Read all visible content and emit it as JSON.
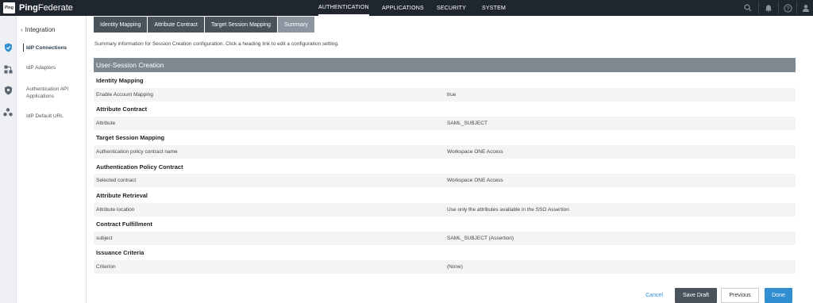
{
  "app": {
    "logo_text": "Ping",
    "brand_bold": "Ping",
    "brand_rest": "Federate"
  },
  "topnav": {
    "items": [
      {
        "label": "AUTHENTICATION",
        "active": true
      },
      {
        "label": "APPLICATIONS",
        "active": false
      },
      {
        "label": "SECURITY",
        "active": false
      },
      {
        "label": "SYSTEM",
        "active": false
      }
    ],
    "icons": [
      "search-icon",
      "bell-icon",
      "help-icon",
      "user-icon"
    ]
  },
  "rail": {
    "icons": [
      "shield-check-icon",
      "connections-icon",
      "shield-icon",
      "cluster-icon"
    ],
    "accent": "#2f8fd0"
  },
  "sidebar": {
    "back_label": "Integration",
    "items": [
      {
        "label": "IdP Connections",
        "active": true
      },
      {
        "label": "IdP Adapters",
        "active": false
      },
      {
        "label": "Authentication API Applications",
        "active": false
      },
      {
        "label": "IdP Default URL",
        "active": false
      }
    ]
  },
  "tabs": [
    {
      "label": "Identity Mapping",
      "active": false
    },
    {
      "label": "Attribute Contract",
      "active": false
    },
    {
      "label": "Target Session Mapping",
      "active": false
    },
    {
      "label": "Summary",
      "active": true
    }
  ],
  "summary_text": "Summary information for Session Creation configuration. Click a heading link to edit a configuration setting.",
  "section_header": "User-Session Creation",
  "groups": [
    {
      "heading": "Identity Mapping",
      "label": "Enable Account Mapping",
      "value": "true"
    },
    {
      "heading": "Attribute Contract",
      "label": "Attribute",
      "value": "SAML_SUBJECT"
    },
    {
      "heading": "Target Session Mapping",
      "label": "Authentication policy contract name",
      "value": "Workspace ONE Access"
    },
    {
      "heading": "Authentication Policy Contract",
      "label": "Selected contract",
      "value": "Workspace ONE Access"
    },
    {
      "heading": "Attribute Retrieval",
      "label": "Attribute location",
      "value": "Use only the attributes available in the SSO Assertion"
    },
    {
      "heading": "Contract Fulfillment",
      "label": "subject",
      "value": "SAML_SUBJECT (Assertion)"
    },
    {
      "heading": "Issuance Criteria",
      "label": "Criterion",
      "value": "(None)"
    }
  ],
  "footer": {
    "cancel": "Cancel",
    "save_draft": "Save Draft",
    "previous": "Previous",
    "done": "Done"
  },
  "colors": {
    "topbar": "#1f262e",
    "tab": "#4a525b",
    "tab_active": "#8b96a1",
    "section_header": "#7d8891",
    "primary": "#2f8fd0"
  }
}
